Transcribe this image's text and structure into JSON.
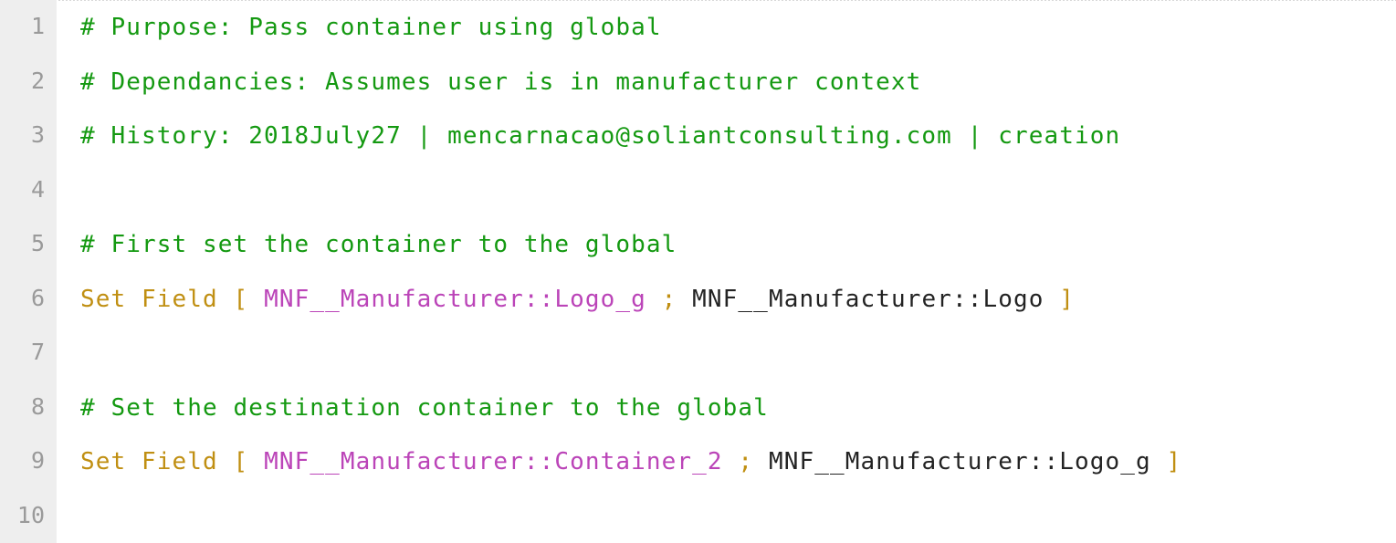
{
  "editor": {
    "kind": "code-editor",
    "language": "FileMaker Script",
    "total_lines": 10,
    "colors": {
      "background": "#ffffff",
      "gutter_background": "#eeeeee",
      "gutter_text": "#9a9a9a",
      "comment": "#149911",
      "keyword": "#c08f12",
      "punctuation": "#c08f12",
      "field_reference": "#bb44b8",
      "plain_text": "#232323"
    }
  },
  "gutter": {
    "line_numbers": [
      "1",
      "2",
      "3",
      "4",
      "5",
      "6",
      "7",
      "8",
      "9",
      "10"
    ]
  },
  "lines": [
    {
      "number": "1",
      "text": "# Purpose: Pass container using global",
      "tokens": [
        {
          "type": "comment",
          "text": "# Purpose: Pass container using global"
        }
      ]
    },
    {
      "number": "2",
      "text": "# Dependancies: Assumes user is in manufacturer context",
      "tokens": [
        {
          "type": "comment",
          "text": "# Dependancies: Assumes user is in manufacturer context"
        }
      ]
    },
    {
      "number": "3",
      "text": "# History: 2018July27 | mencarnacao@soliantconsulting.com | creation",
      "tokens": [
        {
          "type": "comment",
          "text": "# History: 2018July27 | mencarnacao@soliantconsulting.com | creation"
        }
      ]
    },
    {
      "number": "4",
      "text": "",
      "tokens": []
    },
    {
      "number": "5",
      "text": "# First set the container to the global",
      "tokens": [
        {
          "type": "comment",
          "text": "# First set the container to the global"
        }
      ]
    },
    {
      "number": "6",
      "text": "Set Field [ MNF__Manufacturer::Logo_g ; MNF__Manufacturer::Logo ]",
      "tokens": [
        {
          "type": "keyword",
          "text": "Set Field "
        },
        {
          "type": "punct",
          "text": "[ "
        },
        {
          "type": "field",
          "text": "MNF__Manufacturer::Logo_g "
        },
        {
          "type": "punct",
          "text": "; "
        },
        {
          "type": "plain",
          "text": "MNF__Manufacturer::Logo "
        },
        {
          "type": "punct",
          "text": "]"
        }
      ]
    },
    {
      "number": "7",
      "text": "",
      "tokens": []
    },
    {
      "number": "8",
      "text": "# Set the destination container to the global",
      "tokens": [
        {
          "type": "comment",
          "text": "# Set the destination container to the global"
        }
      ]
    },
    {
      "number": "9",
      "text": "Set Field [ MNF__Manufacturer::Container_2 ; MNF__Manufacturer::Logo_g ]",
      "tokens": [
        {
          "type": "keyword",
          "text": "Set Field "
        },
        {
          "type": "punct",
          "text": "[ "
        },
        {
          "type": "field",
          "text": "MNF__Manufacturer::Container_2 "
        },
        {
          "type": "punct",
          "text": "; "
        },
        {
          "type": "plain",
          "text": "MNF__Manufacturer::Logo_g "
        },
        {
          "type": "punct",
          "text": "]"
        }
      ]
    },
    {
      "number": "10",
      "text": "",
      "tokens": []
    }
  ]
}
